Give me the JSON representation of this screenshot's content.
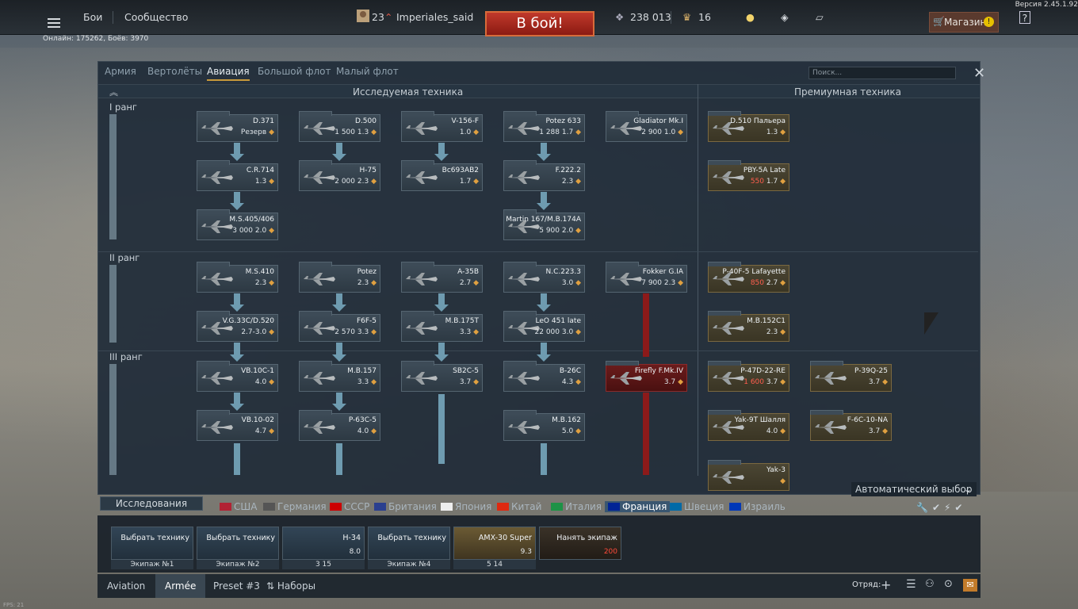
{
  "version": "Версия 2.45.1.92",
  "online": "Онлайн: 175262, Боёв: 3970",
  "fps": "FPS: 21",
  "topbar": {
    "battles": "Бои",
    "community": "Сообщество",
    "level": "23",
    "player": "Imperiales_said",
    "battle_btn": "В бой!",
    "silver": "238 013",
    "eagles": "16",
    "shop": "Магазин",
    "help": "?"
  },
  "panel": {
    "tabs": [
      "Армия",
      "Вертолёты",
      "Авиация",
      "Большой флот",
      "Малый флот"
    ],
    "active_tab": "Авиация",
    "search_placeholder": "Поиск...",
    "head_research": "Исследуемая техника",
    "head_premium": "Премиумная техника",
    "ranks": [
      "I ранг",
      "II ранг",
      "III ранг"
    ],
    "auto_select": "Автоматический выбор"
  },
  "vehicles": [
    {
      "name": "D.371",
      "br": "Резерв",
      "cost": ""
    },
    {
      "name": "D.500",
      "br": "1.3",
      "cost": "1 500"
    },
    {
      "name": "V-156-F",
      "br": "1.0",
      "cost": ""
    },
    {
      "name": "Potez 633",
      "br": "1.7",
      "cost": "1 288"
    },
    {
      "name": "Gladiator Mk.I",
      "br": "1.0",
      "cost": "2 900"
    },
    {
      "name": "D.510 Пальера",
      "br": "1.3",
      "cost": ""
    },
    {
      "name": "C.R.714",
      "br": "1.3",
      "cost": ""
    },
    {
      "name": "H-75",
      "br": "2.3",
      "cost": "2 000"
    },
    {
      "name": "Bc693AB2",
      "br": "1.7",
      "cost": ""
    },
    {
      "name": "F.222.2",
      "br": "2.3",
      "cost": ""
    },
    {
      "name": "PBY-5A Late",
      "br": "1.7",
      "cost": "550"
    },
    {
      "name": "M.S.405/406",
      "br": "2.0",
      "cost": "3 000"
    },
    {
      "name": "Martin 167/M.B.174A",
      "br": "2.0",
      "cost": "5 900"
    },
    {
      "name": "M.S.410",
      "br": "2.3",
      "cost": ""
    },
    {
      "name": "Potez",
      "br": "2.3",
      "cost": ""
    },
    {
      "name": "A-35B",
      "br": "2.7",
      "cost": ""
    },
    {
      "name": "N.C.223.3",
      "br": "3.0",
      "cost": ""
    },
    {
      "name": "Fokker G.IA",
      "br": "2.3",
      "cost": "7 900"
    },
    {
      "name": "P-40F-5 Lafayette",
      "br": "2.7",
      "cost": "850"
    },
    {
      "name": "V.G.33C/D.520",
      "br": "2.7-3.0",
      "cost": ""
    },
    {
      "name": "F6F-5",
      "br": "3.3",
      "cost": "2 570"
    },
    {
      "name": "M.B.175T",
      "br": "3.3",
      "cost": ""
    },
    {
      "name": "LeO 451 late",
      "br": "3.0",
      "cost": "22 000"
    },
    {
      "name": "M.B.152C1",
      "br": "2.3",
      "cost": ""
    },
    {
      "name": "VB.10C-1",
      "br": "4.0",
      "cost": ""
    },
    {
      "name": "M.B.157",
      "br": "3.3",
      "cost": ""
    },
    {
      "name": "SB2C-5",
      "br": "3.7",
      "cost": ""
    },
    {
      "name": "B-26C",
      "br": "4.3",
      "cost": ""
    },
    {
      "name": "Firefly F.Mk.IV",
      "br": "3.7",
      "cost": ""
    },
    {
      "name": "P-47D-22-RE",
      "br": "3.7",
      "cost": "1 600"
    },
    {
      "name": "P-39Q-25",
      "br": "3.7",
      "cost": ""
    },
    {
      "name": "VB.10-02",
      "br": "4.7",
      "cost": ""
    },
    {
      "name": "P-63C-5",
      "br": "4.0",
      "cost": ""
    },
    {
      "name": "M.B.162",
      "br": "5.0",
      "cost": ""
    },
    {
      "name": "Yak-9T Шалля",
      "br": "4.0",
      "cost": ""
    },
    {
      "name": "F-6C-10-NA",
      "br": "3.7",
      "cost": ""
    },
    {
      "name": "Yak-3",
      "br": "",
      "cost": ""
    }
  ],
  "bottom": {
    "research_tab": "Исследования",
    "nations": [
      "США",
      "Германия",
      "СССР",
      "Британия",
      "Япония",
      "Китай",
      "Италия",
      "Франция",
      "Швеция",
      "Израиль"
    ],
    "active_nation": "Франция",
    "slots": [
      {
        "title": "Выбрать технику",
        "sub": "",
        "label": "Экипаж №1"
      },
      {
        "title": "Выбрать технику",
        "sub": "",
        "label": "Экипаж №2"
      },
      {
        "title": "H-34",
        "sub": "8.0",
        "label": "3     15"
      },
      {
        "title": "Выбрать технику",
        "sub": "",
        "label": "Экипаж №4"
      },
      {
        "title": "AMX-30 Super",
        "sub": "9.3",
        "label": "5     14"
      },
      {
        "title": "Нанять экипаж",
        "sub": "200",
        "label": ""
      }
    ],
    "presets": [
      "Aviation",
      "Armée",
      "Preset #3",
      "Наборы"
    ],
    "active_preset": "Armée",
    "squad": "Отряд:"
  },
  "colors": {
    "accent": "#c89a3b",
    "battle": "#c0392b",
    "premium": "#7a6840",
    "research_arrow": "#6e9bb0"
  }
}
